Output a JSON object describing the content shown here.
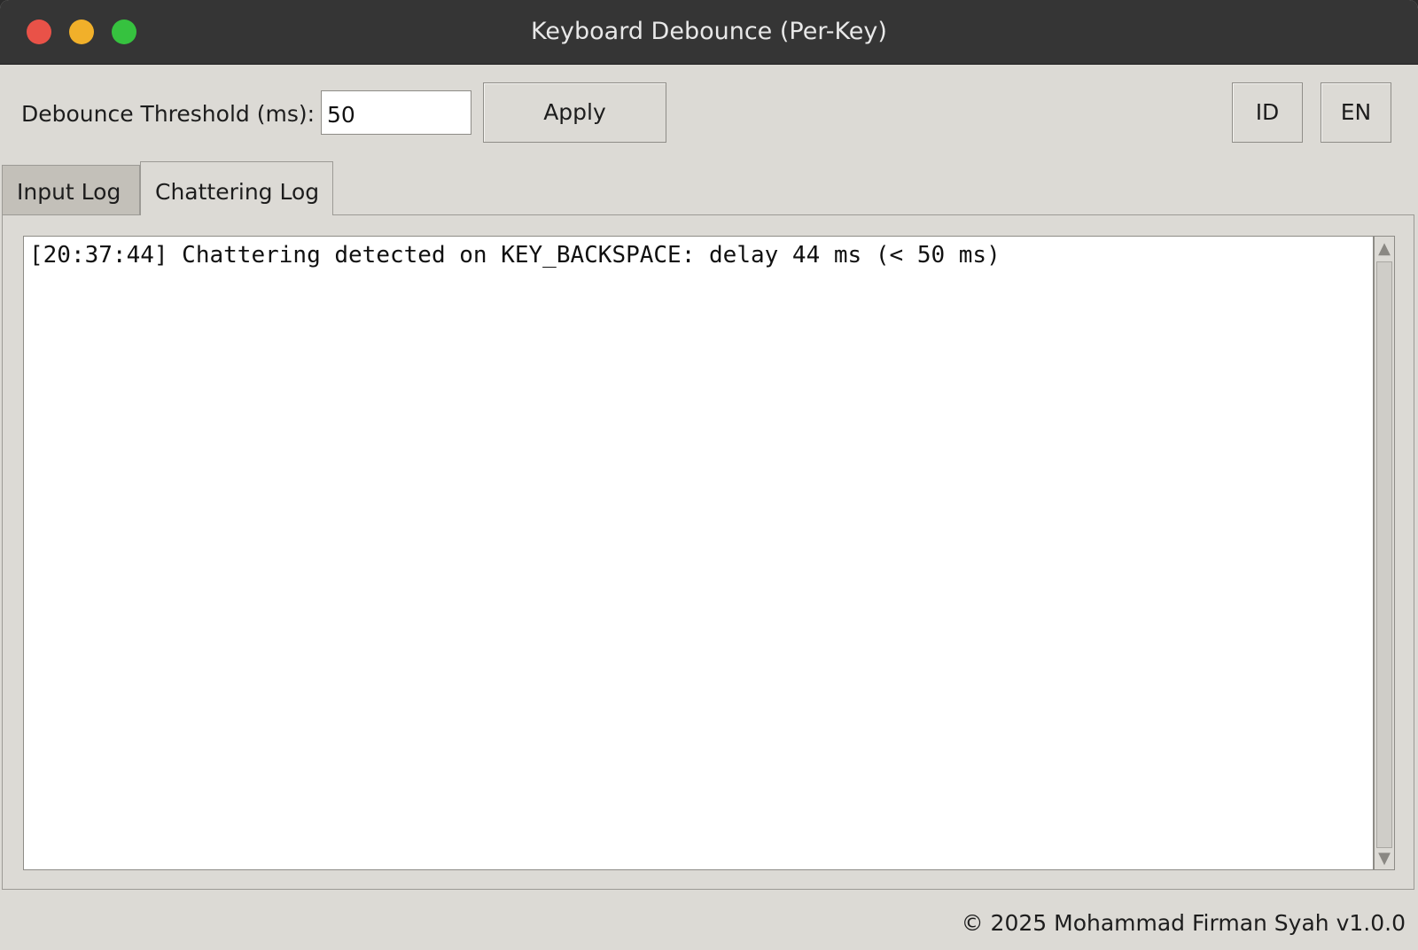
{
  "window": {
    "title": "Keyboard Debounce (Per-Key)"
  },
  "toolbar": {
    "threshold_label": "Debounce Threshold (ms):",
    "threshold_value": "50",
    "apply_label": "Apply",
    "lang_id_label": "ID",
    "lang_en_label": "EN"
  },
  "tabs": [
    {
      "label": "Input Log",
      "selected": false
    },
    {
      "label": "Chattering Log",
      "selected": true
    }
  ],
  "log": {
    "lines": [
      "[20:37:44] Chattering detected on KEY_BACKSPACE: delay 44 ms (< 50 ms)"
    ]
  },
  "footer": {
    "text": "© 2025 Mohammad Firman Syah v1.0.0"
  },
  "colors": {
    "close": "#e95248",
    "minimize": "#f1b02a",
    "zoom": "#36c23f",
    "window_bg": "#dcdad5",
    "titlebar_bg": "#353535"
  },
  "icons": {
    "scroll_up": "triangle-up-icon",
    "scroll_down": "triangle-down-icon"
  }
}
